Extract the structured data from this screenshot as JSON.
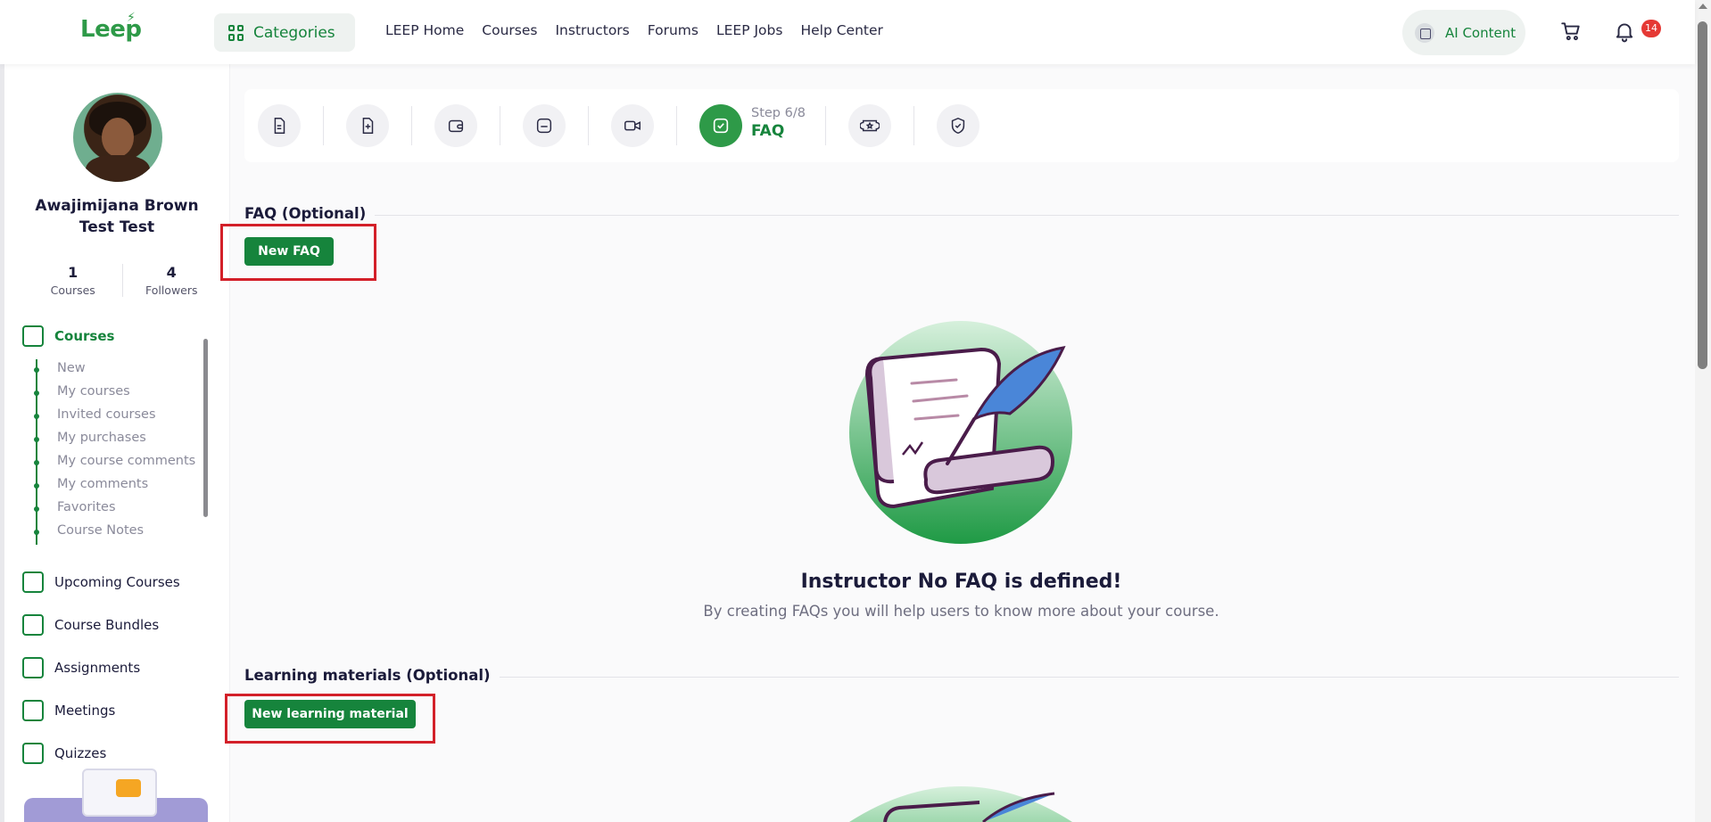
{
  "topbar": {
    "logo_text": "Leep",
    "categories_label": "Categories",
    "nav": [
      "LEEP Home",
      "Courses",
      "Instructors",
      "Forums",
      "LEEP Jobs",
      "Help Center"
    ],
    "ai_label": "AI Content",
    "notification_count": "14"
  },
  "sidebar": {
    "user_name": "Awajimijana Brown Test Test",
    "stats": [
      {
        "value": "1",
        "label": "Courses"
      },
      {
        "value": "4",
        "label": "Followers"
      }
    ],
    "courses_label": "Courses",
    "course_sub_items": [
      "New",
      "My courses",
      "Invited courses",
      "My purchases",
      "My course comments",
      "My comments",
      "Favorites",
      "Course Notes"
    ],
    "menu_items": [
      "Upcoming Courses",
      "Course Bundles",
      "Assignments",
      "Meetings",
      "Quizzes"
    ]
  },
  "stepper": {
    "step_number": "Step 6/8",
    "step_name": "FAQ",
    "icons": [
      "document-icon",
      "add-document-icon",
      "wallet-icon",
      "minus-folder-icon",
      "video-icon",
      "check-square-icon",
      "badge-star-icon",
      "shield-check-icon"
    ]
  },
  "faq": {
    "title": "FAQ (Optional)",
    "button_label": "New FAQ",
    "empty_title": "Instructor No FAQ is defined!",
    "empty_subtitle": "By creating FAQs you will help users to know more about your course."
  },
  "learning": {
    "title": "Learning materials (Optional)",
    "button_label": "New learning material"
  },
  "colors": {
    "brand_green": "#16843c",
    "highlight_red": "#d32029",
    "badge_red": "#e53935"
  }
}
